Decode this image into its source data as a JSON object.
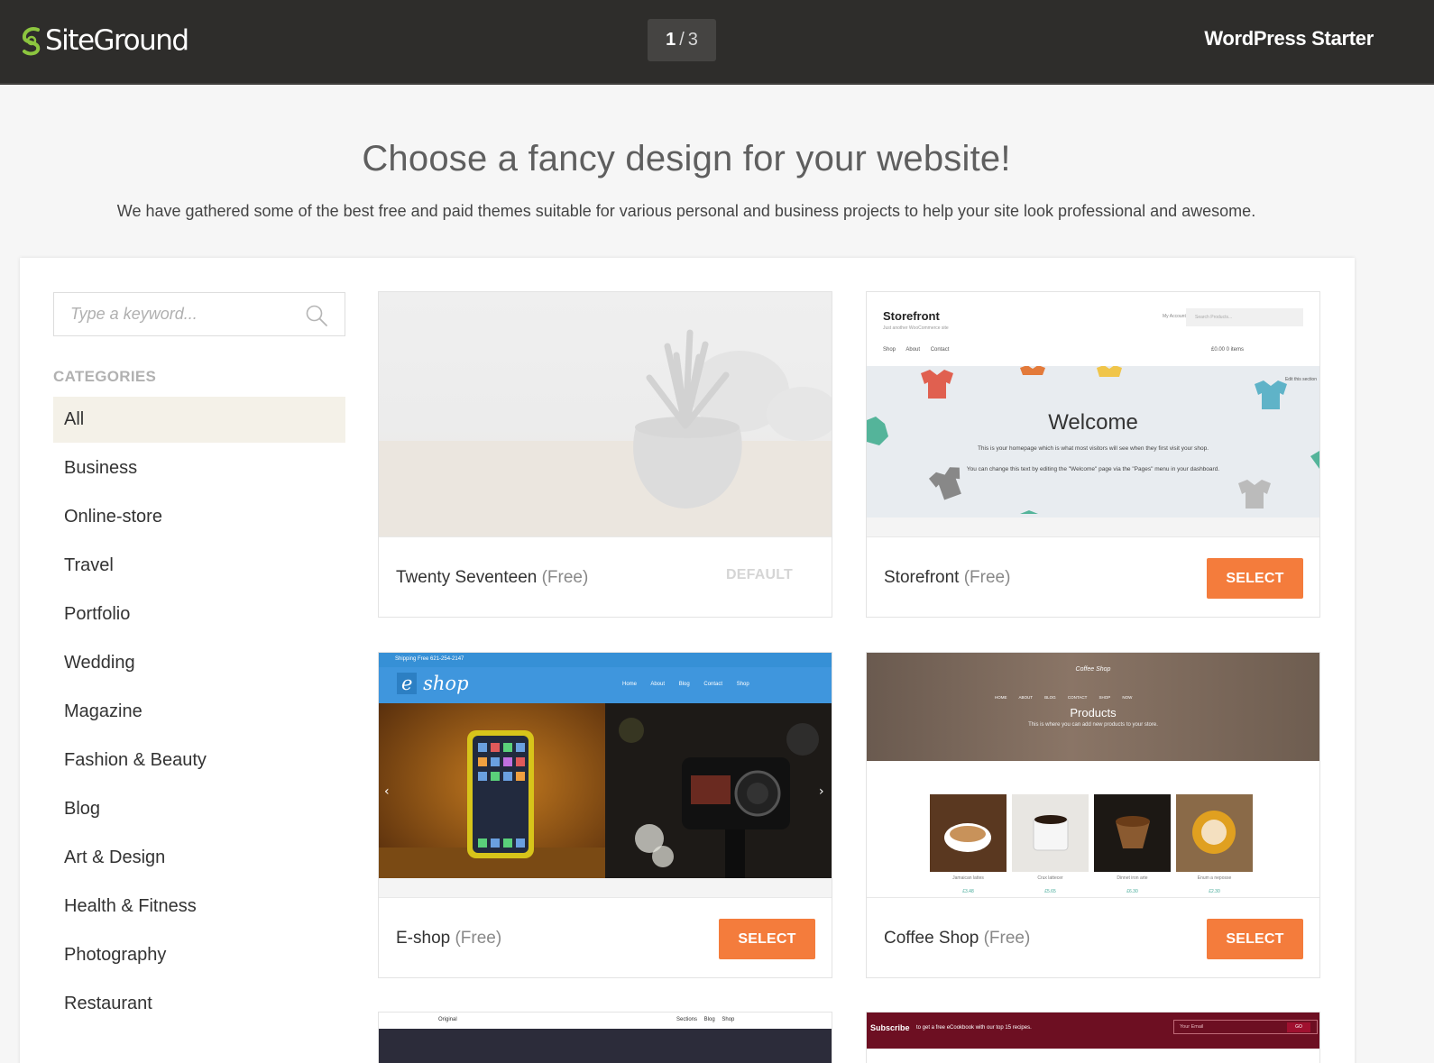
{
  "header": {
    "logo_text": "SiteGround",
    "step_current": "1",
    "step_separator": "/",
    "step_total": "3",
    "title": "WordPress Starter"
  },
  "intro": {
    "heading": "Choose a fancy design for your website!",
    "subtext": "We have gathered some of the best free and paid themes suitable for various personal and business projects to help your site look professional and awesome."
  },
  "sidebar": {
    "search_placeholder": "Type a keyword...",
    "categories_title": "CATEGORIES",
    "categories": [
      {
        "label": "All",
        "active": true
      },
      {
        "label": "Business"
      },
      {
        "label": "Online-store"
      },
      {
        "label": "Travel"
      },
      {
        "label": "Portfolio"
      },
      {
        "label": "Wedding"
      },
      {
        "label": "Magazine"
      },
      {
        "label": "Fashion & Beauty"
      },
      {
        "label": "Blog"
      },
      {
        "label": "Art & Design"
      },
      {
        "label": "Health & Fitness"
      },
      {
        "label": "Photography"
      },
      {
        "label": "Restaurant"
      }
    ]
  },
  "themes": [
    {
      "name": "Twenty Seventeen",
      "price": "(Free)",
      "action": "DEFAULT"
    },
    {
      "name": "Storefront",
      "price": "(Free)",
      "action": "SELECT"
    },
    {
      "name": "E-shop",
      "price": "(Free)",
      "action": "SELECT"
    },
    {
      "name": "Coffee Shop",
      "price": "(Free)",
      "action": "SELECT"
    }
  ],
  "previews": {
    "storefront": {
      "logo": "Storefront",
      "tagline": "Just another WooCommerce site",
      "account": "My Account",
      "search": "Search Products...",
      "nav": "Shop About Contact",
      "cart": "£0.00 0 items",
      "edit": "Edit this section",
      "welcome": "Welcome",
      "line1": "This is your homepage which is what most visitors will see when they first visit your shop.",
      "line2": "You can change this text by editing the \"Welcome\" page via the \"Pages\" menu in your dashboard."
    },
    "eshop": {
      "shipping": "Shipping Free   621-254-2147",
      "logo_e": "e",
      "logo_rest": "shop",
      "menu": "Home About Blog Contact Shop"
    },
    "coffee": {
      "brand": "Coffee Shop",
      "menu": "HOME ABOUT BLOG CONTACT SHOP NOW",
      "title": "Products",
      "subtitle": "This is where you can add new products to your store.",
      "labels": [
        "Jamaican lattes",
        "Crux lattecer",
        "Dinnet iron arte",
        "Enum a neposse"
      ],
      "prices": [
        "£3.48",
        "£5.65",
        "£6.30",
        "£2.30"
      ]
    },
    "original": {
      "brand": "Original",
      "menu": "Sections Blog Shop"
    },
    "recipes": {
      "subscribe": "Subscribe",
      "text": "to get a free eCookbook with our top 15 recipes.",
      "email": "Your Email",
      "go": "GO"
    }
  },
  "colors": {
    "header_bg": "#2e2d2b",
    "accent": "#f47c3c",
    "active_category_bg": "#f4f1e8",
    "logo_green": "#8cc63f"
  }
}
